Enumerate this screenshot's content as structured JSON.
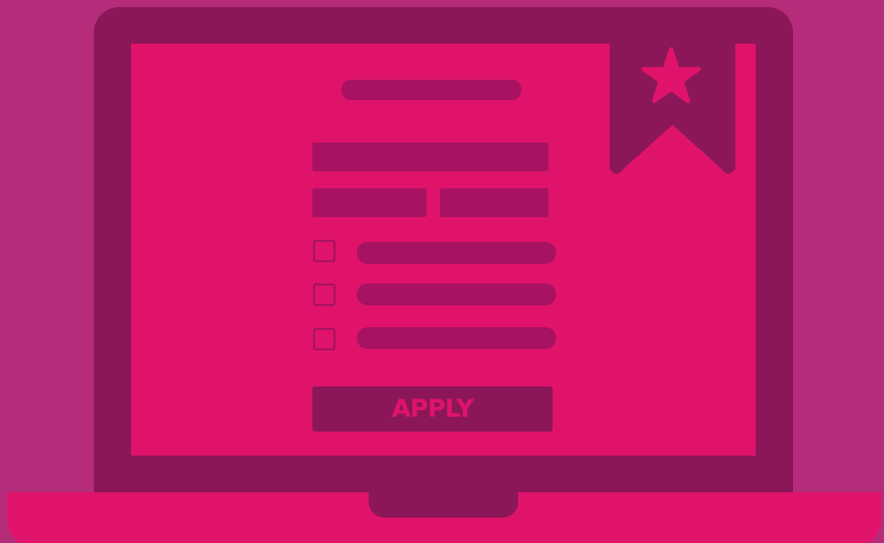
{
  "form": {
    "apply_label": "APPLY"
  },
  "icons": {
    "bookmark": "bookmark-star-icon",
    "checkbox": "empty-checkbox"
  },
  "colors": {
    "background": "#b52d7a",
    "laptop_frame": "#8c1758",
    "screen": "#e0136b",
    "placeholder_bars": "#a81262"
  }
}
